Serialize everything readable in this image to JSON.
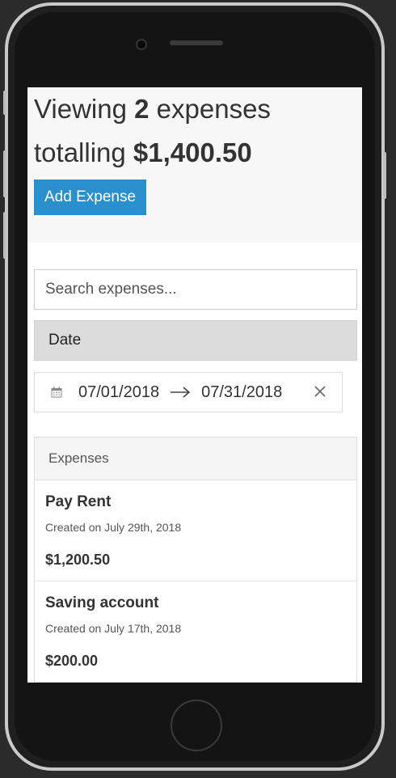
{
  "summary": {
    "prefix": "Viewing",
    "count": "2",
    "count_suffix": "expenses",
    "total_prefix": "totalling",
    "total": "$1,400.50",
    "add_button_label": "Add Expense"
  },
  "filters": {
    "search_placeholder": "Search expenses...",
    "search_value": "",
    "sort_selected": "Date",
    "start_date": "07/01/2018",
    "end_date": "07/31/2018",
    "icons": [
      "calendar-icon",
      "arrow-right-icon",
      "close-icon"
    ]
  },
  "list": {
    "header": "Expenses",
    "items": [
      {
        "title": "Pay Rent",
        "created": "Created on July 29th, 2018",
        "amount": "$1,200.50"
      },
      {
        "title": "Saving account",
        "created": "Created on July 17th, 2018",
        "amount": "$200.00"
      }
    ]
  },
  "colors": {
    "accent": "#2a8fcd",
    "summary_bg": "#f7f7f7",
    "sort_bg": "#dcdcdc"
  }
}
